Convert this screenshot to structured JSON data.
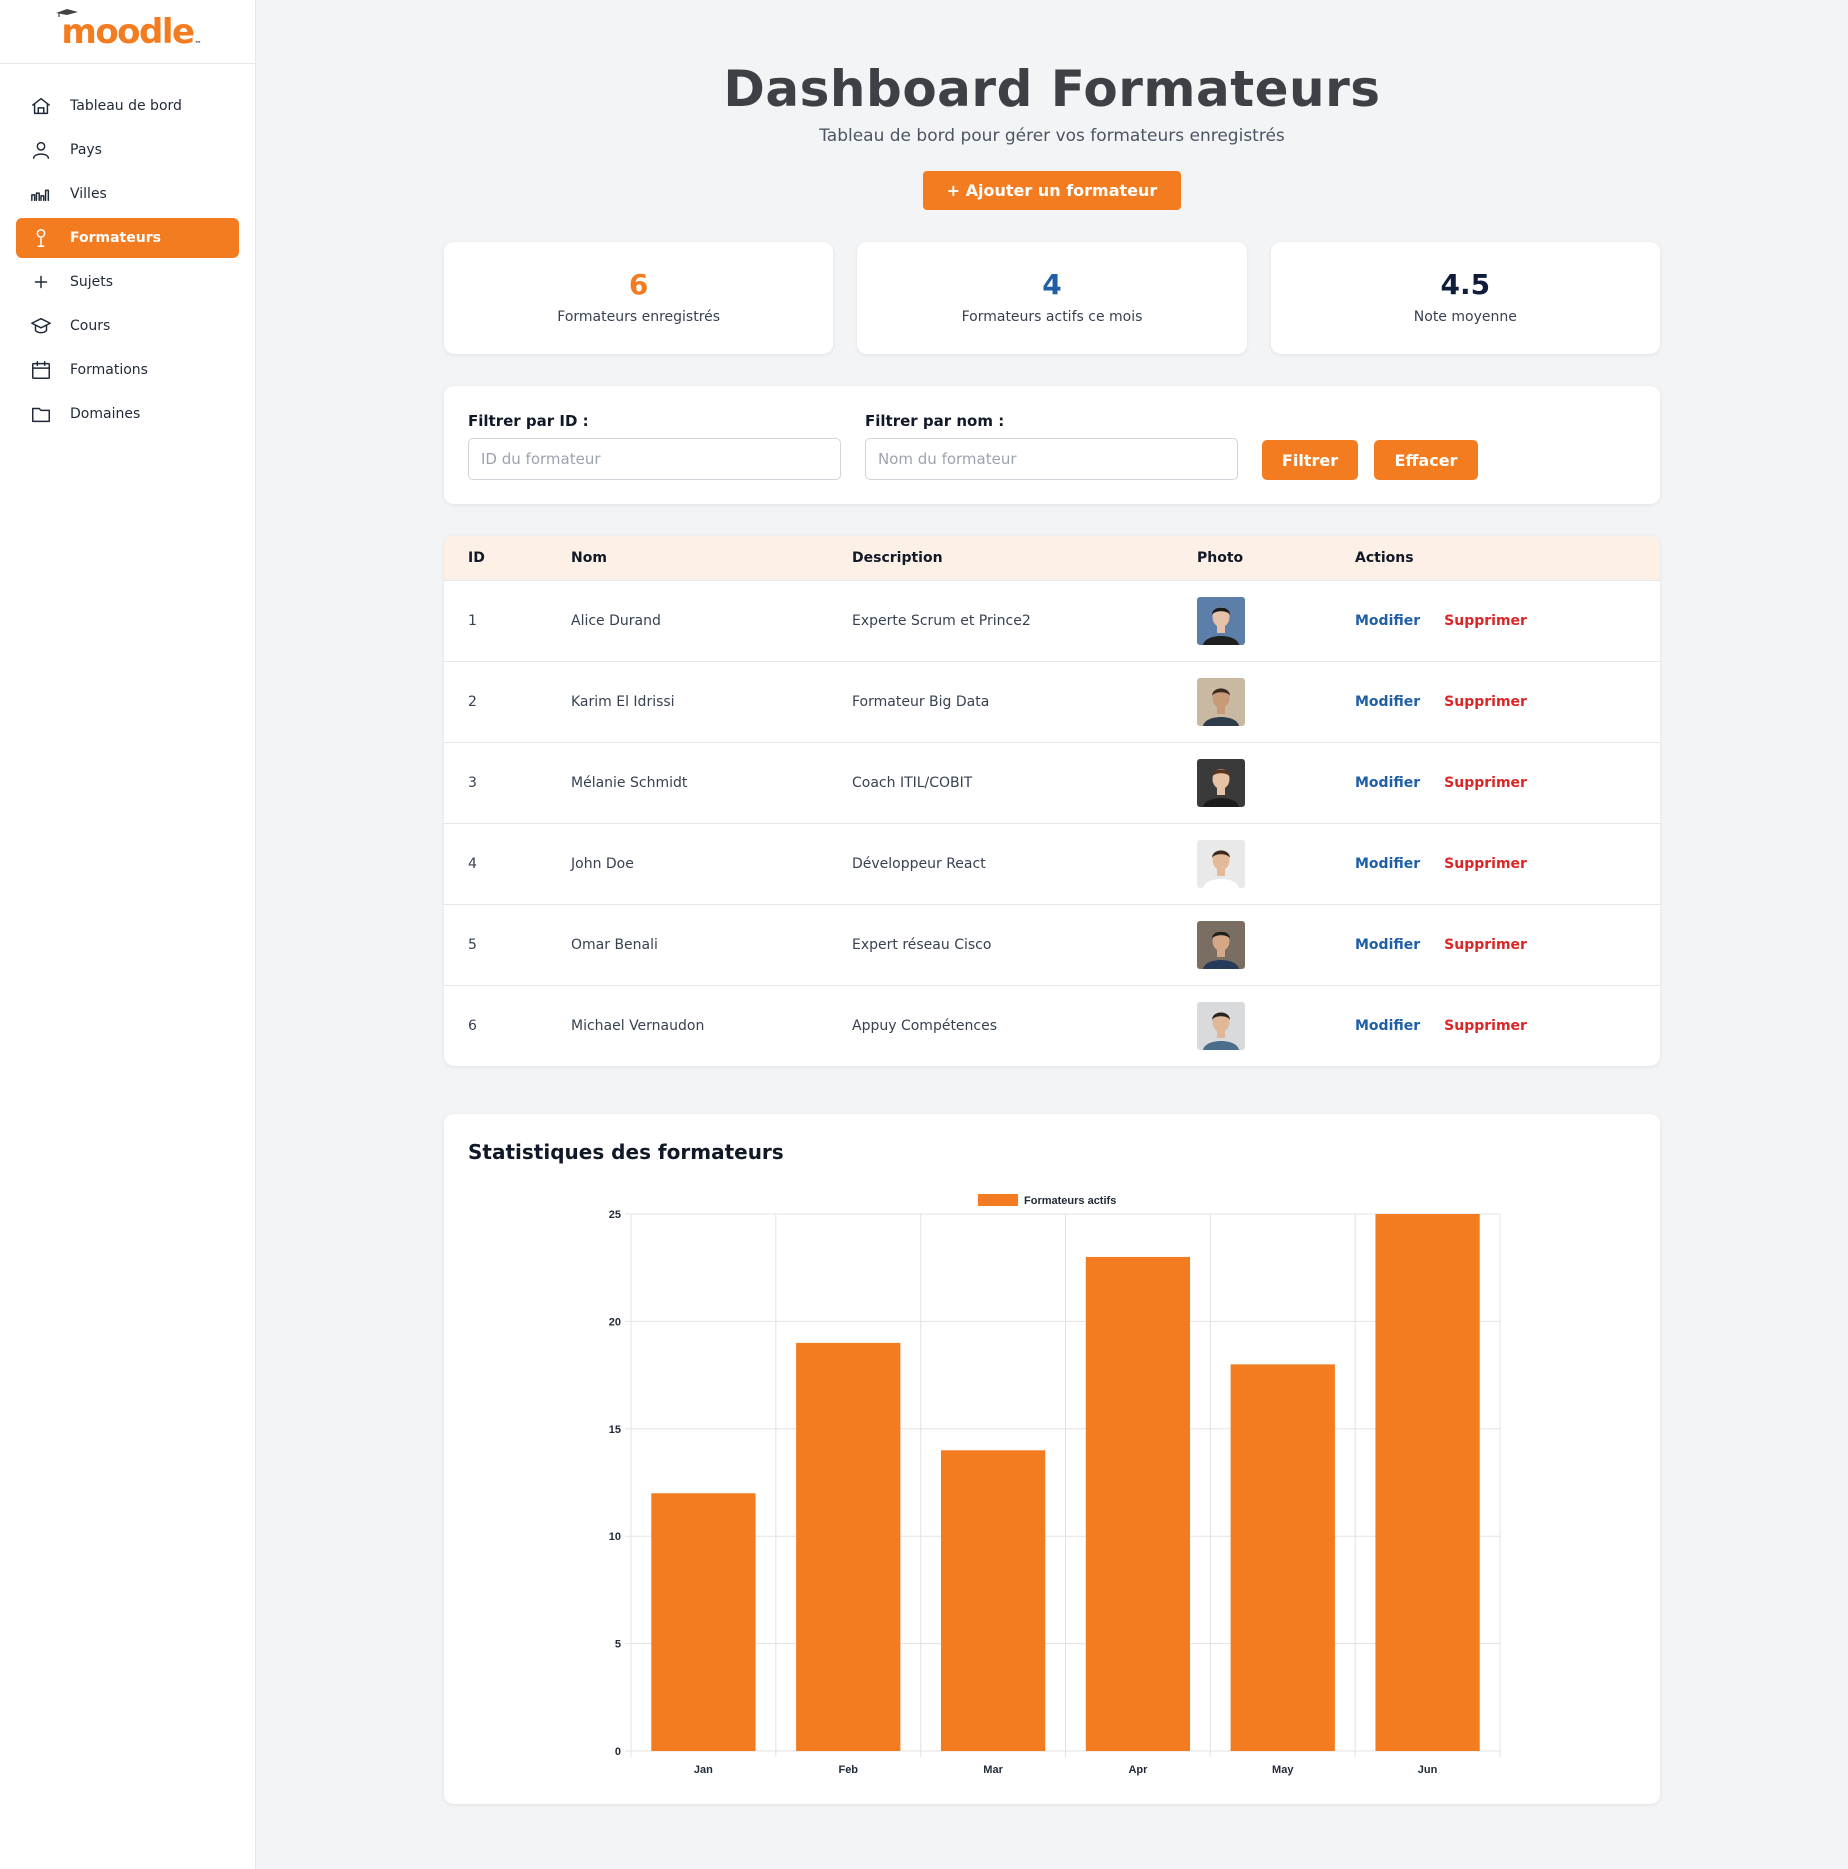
{
  "brand": {
    "logo_text": "moodle",
    "logo_tm": "™"
  },
  "colors": {
    "accent": "#f47c20",
    "blue": "#1e5fa8",
    "red": "#dc2626",
    "dark": "#0f1d3a"
  },
  "sidebar": {
    "items": [
      {
        "label": "Tableau de bord",
        "icon": "home-icon",
        "active": false
      },
      {
        "label": "Pays",
        "icon": "user-icon",
        "active": false
      },
      {
        "label": "Villes",
        "icon": "city-icon",
        "active": false
      },
      {
        "label": "Formateurs",
        "icon": "pin-icon",
        "active": true
      },
      {
        "label": "Sujets",
        "icon": "plus-icon",
        "active": false
      },
      {
        "label": "Cours",
        "icon": "graduation-icon",
        "active": false
      },
      {
        "label": "Formations",
        "icon": "calendar-icon",
        "active": false
      },
      {
        "label": "Domaines",
        "icon": "folder-icon",
        "active": false
      }
    ]
  },
  "header": {
    "title": "Dashboard Formateurs",
    "subtitle": "Tableau de bord pour gérer vos formateurs enregistrés",
    "add_button": "+ Ajouter un formateur"
  },
  "stats": [
    {
      "value": "6",
      "label": "Formateurs enregistrés",
      "color": "#f47c20"
    },
    {
      "value": "4",
      "label": "Formateurs actifs ce mois",
      "color": "#1e5fa8"
    },
    {
      "value": "4.5",
      "label": "Note moyenne",
      "color": "#0f1d3a"
    }
  ],
  "filters": {
    "id_label": "Filtrer par ID :",
    "id_placeholder": "ID du formateur",
    "id_value": "",
    "name_label": "Filtrer par nom :",
    "name_placeholder": "Nom du formateur",
    "name_value": "",
    "filter_button": "Filtrer",
    "clear_button": "Effacer"
  },
  "table": {
    "columns": [
      "ID",
      "Nom",
      "Description",
      "Photo",
      "Actions"
    ],
    "edit_label": "Modifier",
    "delete_label": "Supprimer",
    "rows": [
      {
        "id": "1",
        "nom": "Alice Durand",
        "description": "Experte Scrum et Prince2",
        "photo": "woman-dark-hair"
      },
      {
        "id": "2",
        "nom": "Karim El Idrissi",
        "description": "Formateur Big Data",
        "photo": "man-beard"
      },
      {
        "id": "3",
        "nom": "Mélanie Schmidt",
        "description": "Coach ITIL/COBIT",
        "photo": "woman-brown-hair"
      },
      {
        "id": "4",
        "nom": "John Doe",
        "description": "Développeur React",
        "photo": "man-smiling"
      },
      {
        "id": "5",
        "nom": "Omar Benali",
        "description": "Expert réseau Cisco",
        "photo": "man-glasses"
      },
      {
        "id": "6",
        "nom": "Michael Vernaudon",
        "description": "Appuy Compétences",
        "photo": "man-young"
      }
    ]
  },
  "chart_section": {
    "title": "Statistiques des formateurs"
  },
  "chart_data": {
    "type": "bar",
    "categories": [
      "Jan",
      "Feb",
      "Mar",
      "Apr",
      "May",
      "Jun"
    ],
    "series": [
      {
        "name": "Formateurs actifs",
        "values": [
          12,
          19,
          14,
          23,
          18,
          25
        ],
        "color": "#f47c20"
      }
    ],
    "yticks": [
      "0",
      "5",
      "10",
      "15",
      "20",
      "25"
    ],
    "ylim": [
      0,
      25
    ],
    "grid": true,
    "legend": "top-center"
  }
}
